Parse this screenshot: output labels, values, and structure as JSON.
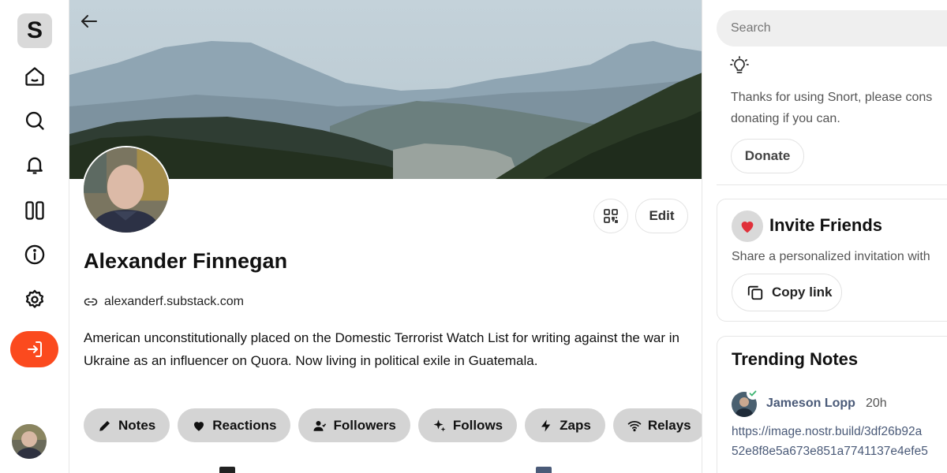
{
  "app": {
    "logo_letter": "S",
    "accent_color": "#fb4a1e"
  },
  "nav": {
    "items": [
      {
        "icon": "home-icon"
      },
      {
        "icon": "search-icon"
      },
      {
        "icon": "bell-icon"
      },
      {
        "icon": "columns-icon"
      },
      {
        "icon": "info-icon"
      },
      {
        "icon": "gear-icon"
      }
    ],
    "login_icon": "login-icon"
  },
  "profile": {
    "name": "Alexander Finnegan",
    "website": "alexanderf.substack.com",
    "bio": "American unconstitutionally placed on the Domestic Terrorist Watch List for writing against the war in Ukraine as an influencer on Quora. Now living in political exile in Guatemala.",
    "edit_label": "Edit",
    "tabs": [
      {
        "label": "Notes",
        "icon": "pencil-icon"
      },
      {
        "label": "Reactions",
        "icon": "heart-icon"
      },
      {
        "label": "Followers",
        "icon": "user-icon"
      },
      {
        "label": "Follows",
        "icon": "sparkle-icon"
      },
      {
        "label": "Zaps",
        "icon": "lightning-icon"
      },
      {
        "label": "Relays",
        "icon": "wifi-icon"
      }
    ]
  },
  "sidebar": {
    "search_placeholder": "Search",
    "tip_text_line1": "Thanks for using Snort, please cons",
    "tip_text_line2": "donating if you can.",
    "donate_label": "Donate",
    "invite": {
      "title": "Invite Friends",
      "subtitle": "Share a personalized invitation with",
      "copy_label": "Copy link"
    },
    "trending": {
      "title": "Trending Notes",
      "author": "Jameson Lopp",
      "time": "20h",
      "text_line1": "https://image.nostr.build/3df26b92a",
      "text_line2": "52e8f8e5a673e851a7741137e4efe5"
    }
  }
}
